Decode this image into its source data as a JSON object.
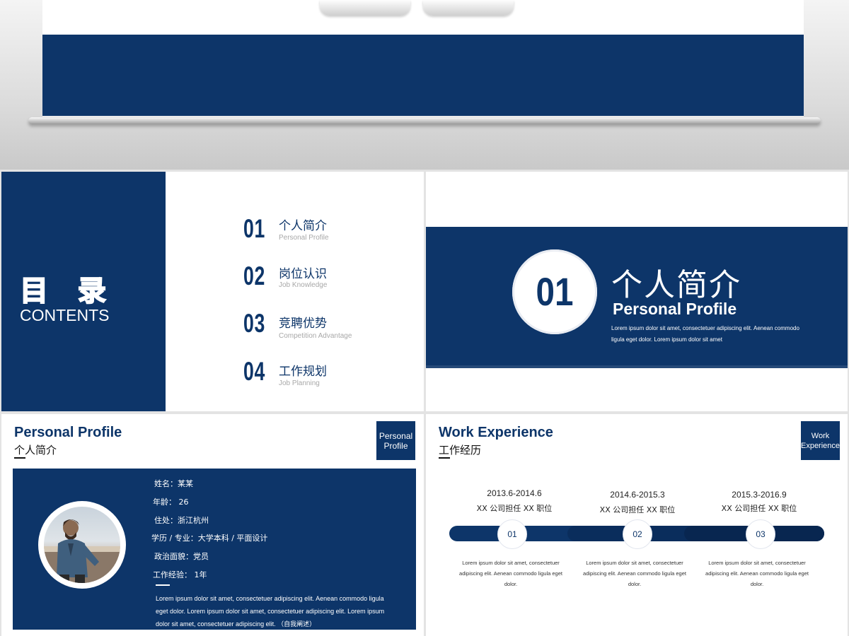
{
  "contents": {
    "title_zh": "目 录",
    "title_en": "CONTENTS",
    "items": [
      {
        "num": "01",
        "zh": "个人简介",
        "en": "Personal Profile"
      },
      {
        "num": "02",
        "zh": "岗位认识",
        "en": "Job Knowledge"
      },
      {
        "num": "03",
        "zh": "竞聘优势",
        "en": "Competition Advantage"
      },
      {
        "num": "04",
        "zh": "工作规划",
        "en": "Job Planning"
      }
    ]
  },
  "section": {
    "num": "01",
    "title_zh": "个人简介",
    "title_en": "Personal Profile",
    "desc": "Lorem ipsum dolor sit amet, consectetuer adipiscing elit. Aenean commodo ligula eget dolor. Lorem ipsum dolor sit amet"
  },
  "profile": {
    "heading_en": "Personal Profile",
    "heading_zh": "个人简介",
    "tag": "Personal Profile",
    "fields": [
      "姓名：某某",
      "年龄： 26",
      "住处：浙江杭州",
      "学历 / 专业：大学本科 / 平面设计",
      "政治面貌：党员",
      "工作经验： 1年"
    ],
    "desc": "Lorem ipsum dolor sit amet, consectetuer adipiscing elit. Aenean commodo ligula eget dolor. Lorem ipsum dolor sit amet, consectetuer adipiscing elit. Lorem ipsum dolor sit amet, consectetuer adipiscing elit. （自我阐述）"
  },
  "work": {
    "heading_en": "Work Experience",
    "heading_zh": "工作经历",
    "tag": "Work Experience",
    "entries": [
      {
        "date": "2013.6-2014.6",
        "role": "XX 公司担任 XX 职位",
        "num": "01",
        "desc": "Lorem ipsum dolor sit amet, consectetuer adipiscing elit. Aenean commodo ligula eget dolor."
      },
      {
        "date": "2014.6-2015.3",
        "role": "XX 公司担任 XX 职位",
        "num": "02",
        "desc": "Lorem ipsum dolor sit amet, consectetuer adipiscing elit. Aenean commodo ligula eget dolor."
      },
      {
        "date": "2015.3-2016.9",
        "role": "XX 公司担任 XX 职位",
        "num": "03",
        "desc": "Lorem ipsum dolor sit amet, consectetuer adipiscing elit. Aenean commodo ligula eget dolor."
      }
    ]
  },
  "colors": {
    "navy": "#0d3569",
    "background": "#e3e3e3"
  }
}
